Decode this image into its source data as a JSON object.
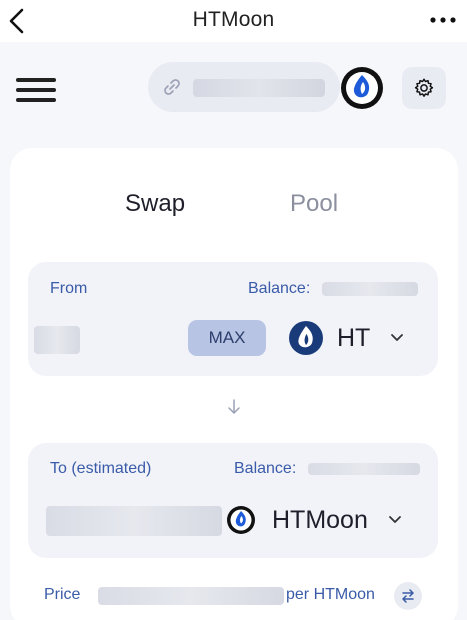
{
  "navbar": {
    "title": "HTMoon"
  },
  "header": {
    "url_placeholder": ""
  },
  "tabs": [
    {
      "label": "Swap",
      "active": true
    },
    {
      "label": "Pool",
      "active": false
    }
  ],
  "from": {
    "label": "From",
    "balance_label": "Balance:",
    "max_label": "MAX",
    "token": "HT"
  },
  "to": {
    "label": "To (estimated)",
    "balance_label": "Balance:",
    "token": "HTMoon"
  },
  "price": {
    "label": "Price",
    "unit": "per HTMoon"
  },
  "colors": {
    "accent": "#3a5ba8",
    "max_bg": "#b8c4e3",
    "panel_bg": "#f1f3f9",
    "page_bg": "#f6f7fb"
  },
  "icons": [
    "back-arrow-icon",
    "more-dots-icon",
    "menu-icon",
    "link-icon",
    "htmoon-logo-icon",
    "gear-icon",
    "ht-flame-icon",
    "chevron-down-icon",
    "arrow-down-icon",
    "swap-rate-icon"
  ]
}
